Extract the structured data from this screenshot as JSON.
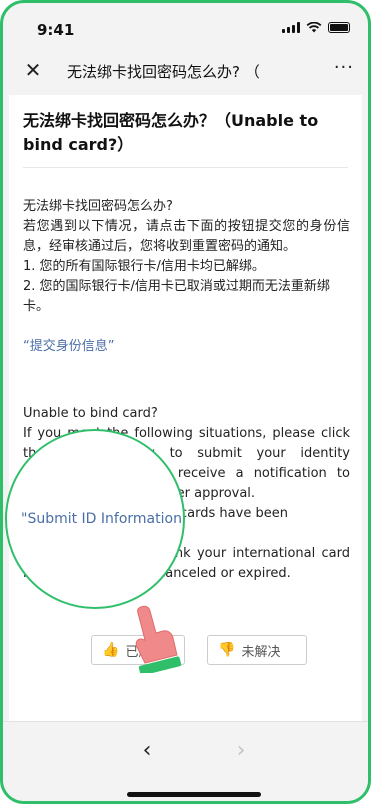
{
  "status": {
    "time": "9:41"
  },
  "nav": {
    "close_icon": "close-icon",
    "title": "无法绑卡找回密码怎么办?  （",
    "more_label": "···"
  },
  "article": {
    "title": "无法绑卡找回密码怎么办？（Unable to bind card?）",
    "zh": {
      "heading": "无法绑卡找回密码怎么办?",
      "para": "若您遇到以下情况，请点击下面的按钮提交您的身份信息，经审核通过后，您将收到重置密码的通知。",
      "item1": "1. 您的所有国际银行卡/信用卡均已解绑。",
      "item2": "2. 您的国际银行卡/信用卡已取消或过期而无法重新绑卡。",
      "link": "“提交身份信息”"
    },
    "en": {
      "heading": "Unable to bind card?",
      "para": "If you meet the following situations, please click the button below to submit your identity information, you will receive a notification to reset your password after approval.",
      "item1": "1. All your international cards have been unlinked.",
      "item2": "2. You are unable to link your international card because it has been canceled or expired."
    }
  },
  "magnifier": {
    "text": "\"Submit ID Information\""
  },
  "feedback": {
    "solved": "已解决",
    "unsolved": "未解决"
  },
  "bottom": {
    "back": "‹",
    "forward": "›"
  },
  "colors": {
    "accent": "#2fbf6a",
    "link": "#4a6ea8"
  }
}
